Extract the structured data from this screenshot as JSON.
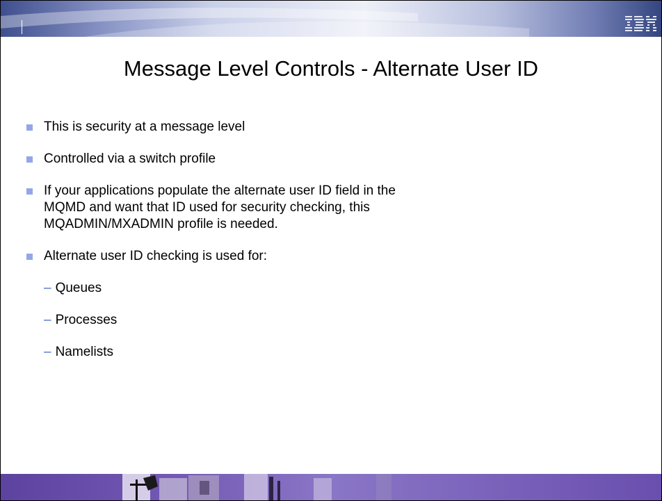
{
  "header": {
    "logo_text": "IBM",
    "colors": {
      "band_dark": "#3f4f8e",
      "band_light": "#eef0f8"
    }
  },
  "title": "Message Level Controls - Alternate User ID",
  "bullets": [
    {
      "text": "This is security at a message level"
    },
    {
      "text": "Controlled via a switch profile"
    },
    {
      "lines": [
        "If your applications populate the alternate user ID field in the",
        "MQMD and want that ID used for security checking, this",
        "MQADMIN/MXADMIN profile is needed."
      ]
    },
    {
      "text": "Alternate user ID checking is used for:"
    }
  ],
  "sub_bullets": [
    {
      "marker": "–",
      "text": "Queues"
    },
    {
      "marker": "–",
      "text": "Processes"
    },
    {
      "marker": "–",
      "text": "Namelists"
    }
  ],
  "colors": {
    "bullet_marker": "#92a8e6",
    "dash_marker": "#4e6cc4",
    "footer_band": "#7257b3"
  }
}
